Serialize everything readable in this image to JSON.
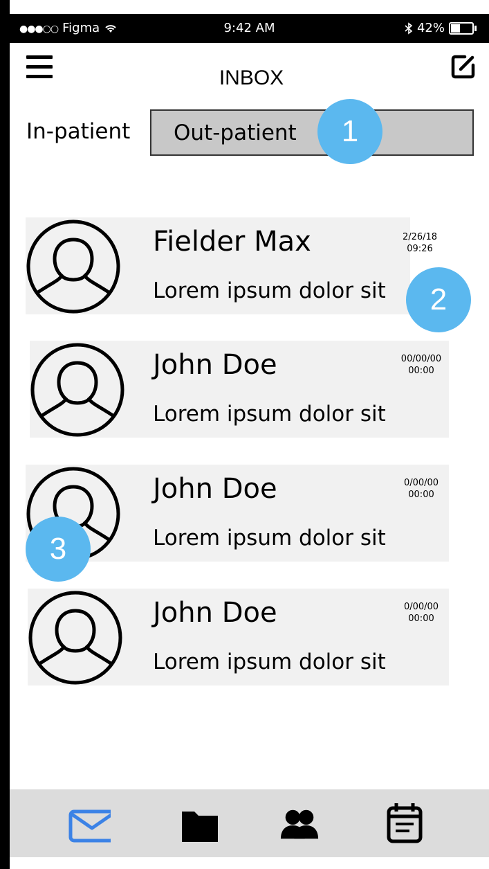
{
  "status_bar": {
    "carrier": "Figma",
    "time": "9:42 AM",
    "battery": "42%"
  },
  "header": {
    "title": "INBOX"
  },
  "segments": {
    "inpatient": "In-patient",
    "outpatient": "Out-patient"
  },
  "badges": [
    "1",
    "2",
    "3"
  ],
  "messages": [
    {
      "name": "Fielder Max",
      "preview": "Lorem ipsum dolor sit",
      "date": "2/26/18",
      "time": "09:26"
    },
    {
      "name": "John Doe",
      "preview": "Lorem ipsum dolor sit",
      "date": "00/00/00",
      "time": "00:00"
    },
    {
      "name": "John Doe",
      "preview": "Lorem ipsum dolor sit",
      "date": "0/00/00",
      "time": "00:00"
    },
    {
      "name": "John Doe",
      "preview": "Lorem ipsum dolor sit",
      "date": "0/00/00",
      "time": "00:00"
    }
  ],
  "tabbar": {
    "items": [
      "mail-icon",
      "folder-icon",
      "users-icon",
      "calendar-icon"
    ],
    "active_color": "#3b82e6"
  },
  "colors": {
    "badge": "#5bb8ef",
    "segment_bg": "#c8c8c8",
    "row_bg": "#f1f1f1",
    "tabbar_bg": "#dcdcdc"
  }
}
